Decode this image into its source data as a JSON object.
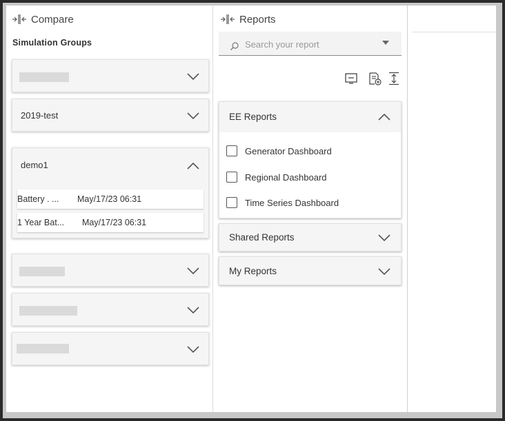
{
  "compare": {
    "title": "Compare",
    "section_label": "Simulation Groups",
    "groups": [
      {
        "label": "",
        "redacted": true,
        "expanded": false
      },
      {
        "label": "2019-test",
        "redacted": false,
        "expanded": false
      },
      {
        "label": "demo1",
        "redacted": false,
        "expanded": true,
        "simulations": [
          {
            "name": "Battery . ...",
            "date": "May/17/23 06:31"
          },
          {
            "name": "1 Year Bat...",
            "date": "May/17/23 06:31"
          }
        ]
      },
      {
        "label": "",
        "redacted": true,
        "expanded": false
      },
      {
        "label": "",
        "redacted": true,
        "expanded": false
      },
      {
        "label": "",
        "redacted": true,
        "expanded": false
      }
    ]
  },
  "reports": {
    "title": "Reports",
    "search": {
      "placeholder": "Search your report",
      "value": ""
    },
    "toolbar": [
      "deselect-icon",
      "add-report-icon",
      "expand-all-icon"
    ],
    "sections": [
      {
        "label": "EE Reports",
        "expanded": true,
        "items": [
          {
            "label": "Generator Dashboard",
            "checked": false
          },
          {
            "label": "Regional Dashboard",
            "checked": false
          },
          {
            "label": "Time Series Dashboard",
            "checked": false
          }
        ]
      },
      {
        "label": "Shared Reports",
        "expanded": false
      },
      {
        "label": "My Reports",
        "expanded": false
      }
    ]
  },
  "colors": {
    "frame": "#c8c8c8",
    "card_bg": "#f5f5f5",
    "text": "#333333",
    "redaction": "#dadada"
  }
}
